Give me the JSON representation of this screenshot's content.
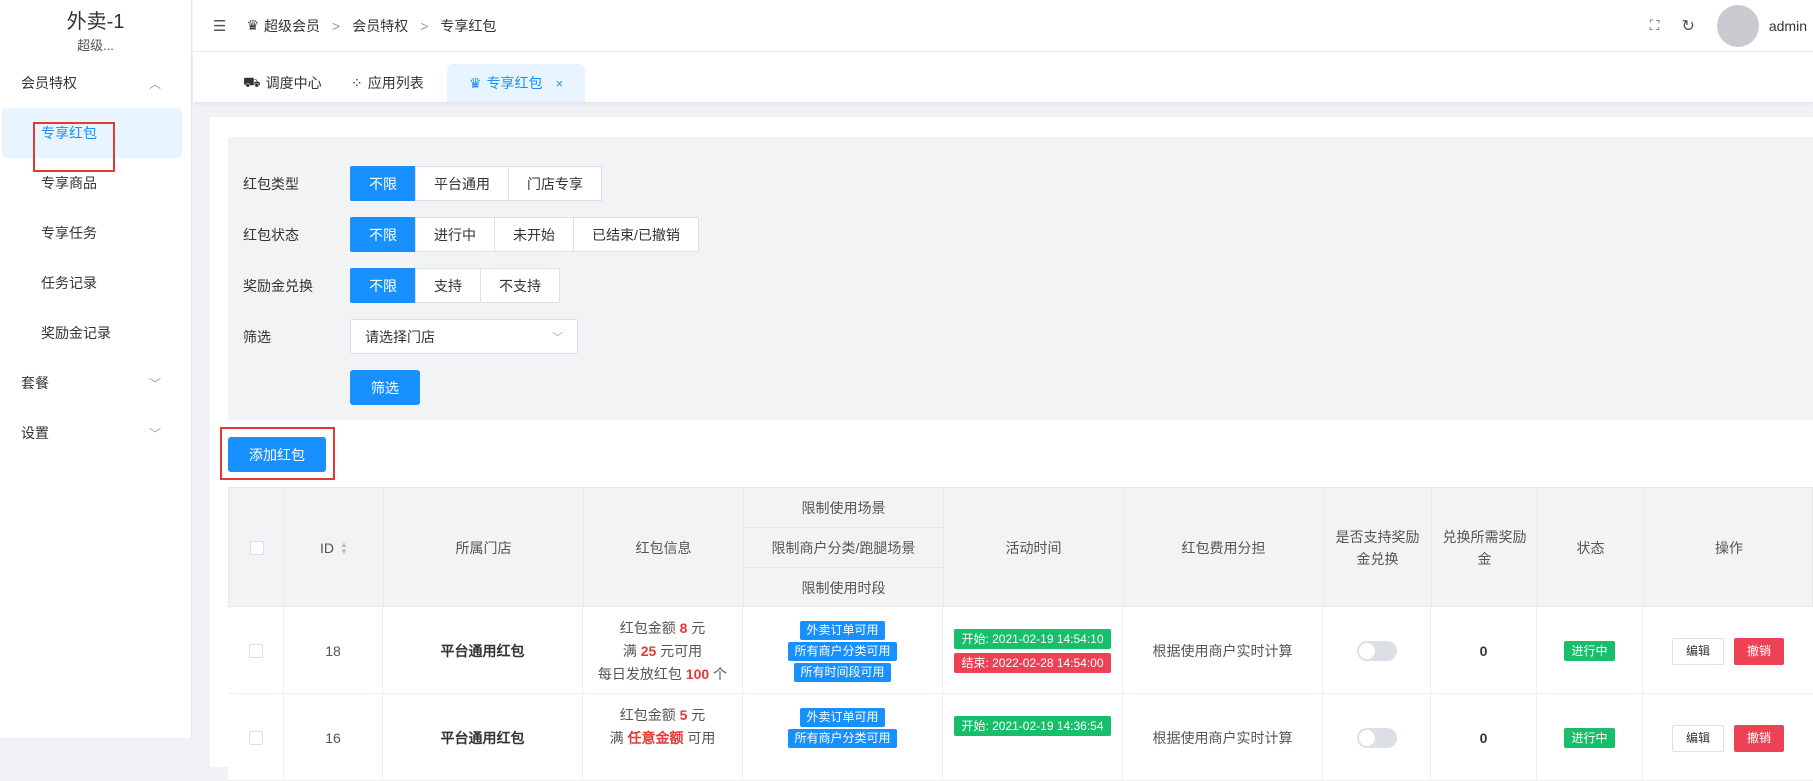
{
  "sidebar": {
    "app_title": "外卖-1",
    "app_subtitle": "超级...",
    "group_member": "会员特权",
    "items": [
      "专享红包",
      "专享商品",
      "专享任务",
      "任务记录",
      "奖励金记录"
    ],
    "group_package": "套餐",
    "group_settings": "设置"
  },
  "header": {
    "breadcrumb": [
      "超级会员",
      "会员特权",
      "专享红包"
    ],
    "breadcrumb_sep": ">",
    "user": "admin"
  },
  "tabs": [
    {
      "label": "调度中心"
    },
    {
      "label": "应用列表"
    },
    {
      "label": "专享红包",
      "close": "×"
    }
  ],
  "filter": {
    "type_label": "红包类型",
    "type_options": [
      "不限",
      "平台通用",
      "门店专享"
    ],
    "status_label": "红包状态",
    "status_options": [
      "不限",
      "进行中",
      "未开始",
      "已结束/已撤销"
    ],
    "reward_label": "奖励金兑换",
    "reward_options": [
      "不限",
      "支持",
      "不支持"
    ],
    "filter_label": "筛选",
    "store_placeholder": "请选择门店",
    "filter_button": "筛选"
  },
  "add_button": "添加红包",
  "table": {
    "headers": {
      "id": "ID",
      "store": "所属门店",
      "info": "红包信息",
      "scene": "限制使用场景",
      "category": "限制商户分类/跑腿场景",
      "period": "限制使用时段",
      "time": "活动时间",
      "cost": "红包费用分担",
      "reward": "是否支持奖励金兑换",
      "need": "兑换所需奖励金",
      "status": "状态",
      "ops": "操作"
    },
    "rows": [
      {
        "id": "18",
        "store": "平台通用红包",
        "amount_pre": "红包金额 ",
        "amount": "8",
        "amount_post": " 元",
        "cond_pre": "满 ",
        "cond": "25",
        "cond_post": " 元可用",
        "daily_pre": "每日发放红包 ",
        "daily": "100",
        "daily_post": " 个",
        "tags": [
          "外卖订单可用",
          "所有商户分类可用",
          "所有时间段可用"
        ],
        "start": "开始: 2021-02-19 14:54:10",
        "end": "结束: 2022-02-28 14:54:00",
        "cost": "根据使用商户实时计算",
        "need": "0",
        "status": "进行中",
        "edit": "编辑",
        "revoke": "撤销"
      },
      {
        "id": "16",
        "store": "平台通用红包",
        "amount_pre": "红包金额 ",
        "amount": "5",
        "amount_post": " 元",
        "cond_pre": "满 ",
        "cond": "任意金额",
        "cond_post": " 可用",
        "tags": [
          "外卖订单可用",
          "所有商户分类可用"
        ],
        "start": "开始: 2021-02-19 14:36:54",
        "cost": "根据使用商户实时计算",
        "need": "0",
        "status": "进行中",
        "edit": "编辑",
        "revoke": "撤销"
      }
    ]
  }
}
